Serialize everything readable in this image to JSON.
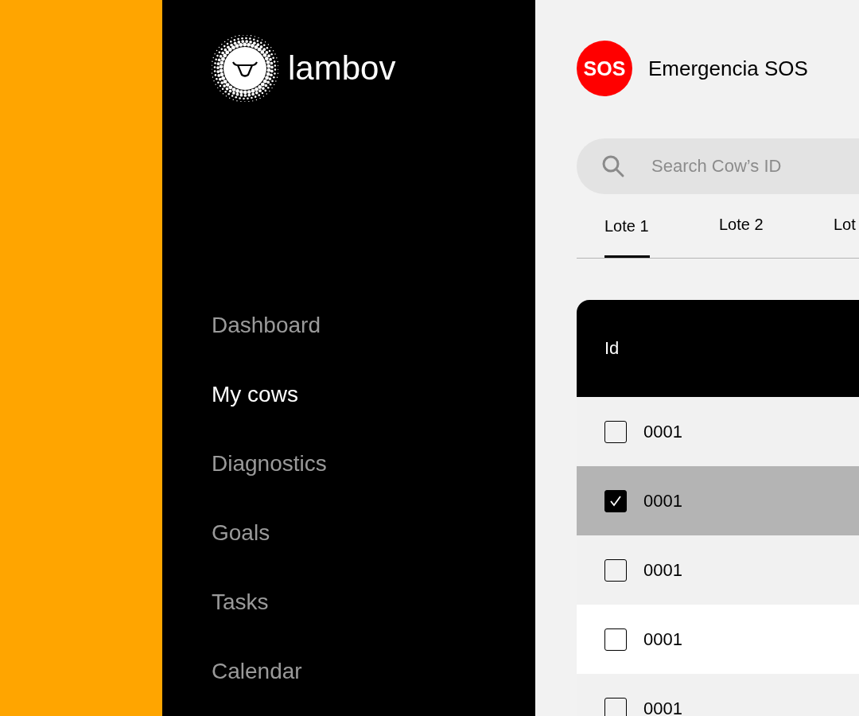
{
  "brand": {
    "name": "lambov"
  },
  "nav": [
    {
      "label": "Dashboard",
      "selected": false
    },
    {
      "label": "My cows",
      "selected": true
    },
    {
      "label": "Diagnostics",
      "selected": false
    },
    {
      "label": "Goals",
      "selected": false
    },
    {
      "label": "Tasks",
      "selected": false
    },
    {
      "label": "Calendar",
      "selected": false
    }
  ],
  "sos": {
    "badge": "SOS",
    "label": "Emergencia SOS"
  },
  "search": {
    "placeholder": "Search Cow’s ID"
  },
  "tabs": [
    {
      "label": "Lote 1",
      "selected": true
    },
    {
      "label": "Lote 2",
      "selected": false
    },
    {
      "label": "Lot",
      "selected": false
    }
  ],
  "table": {
    "columns": [
      "Id"
    ],
    "rows": [
      {
        "id": "0001",
        "checked": false,
        "selected": false
      },
      {
        "id": "0001",
        "checked": true,
        "selected": true
      },
      {
        "id": "0001",
        "checked": false,
        "selected": false
      },
      {
        "id": "0001",
        "checked": false,
        "selected": false
      },
      {
        "id": "0001",
        "checked": false,
        "selected": false
      }
    ]
  }
}
